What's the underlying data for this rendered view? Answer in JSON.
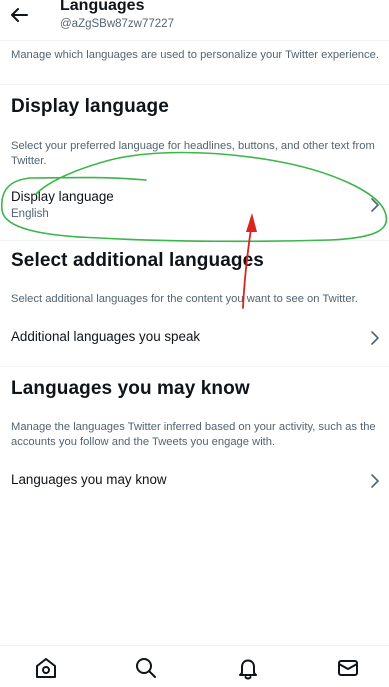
{
  "header": {
    "title": "Languages",
    "handle": "@aZgSBw87zw77227"
  },
  "intro": "Manage which languages are used to personalize your Twitter experience.",
  "display_section": {
    "heading": "Display language",
    "description": "Select your preferred language for headlines, buttons, and other text from Twitter.",
    "row_label": "Display language",
    "row_value": "English"
  },
  "additional_section": {
    "heading": "Select additional languages",
    "description": "Select additional languages for the content you want to see on Twitter.",
    "row_label": "Additional languages you speak"
  },
  "may_know_section": {
    "heading": "Languages you may know",
    "description": "Manage the languages Twitter inferred based on your activity, such as the accounts you follow and the Tweets you engage with.",
    "row_label": "Languages you may know"
  },
  "bottom_nav": {
    "items": [
      "home-icon",
      "search-icon",
      "notifications-icon",
      "messages-icon"
    ]
  },
  "colors": {
    "annotation_green": "#3cb54a",
    "annotation_red": "#d9251d",
    "muted_text": "#536471"
  }
}
